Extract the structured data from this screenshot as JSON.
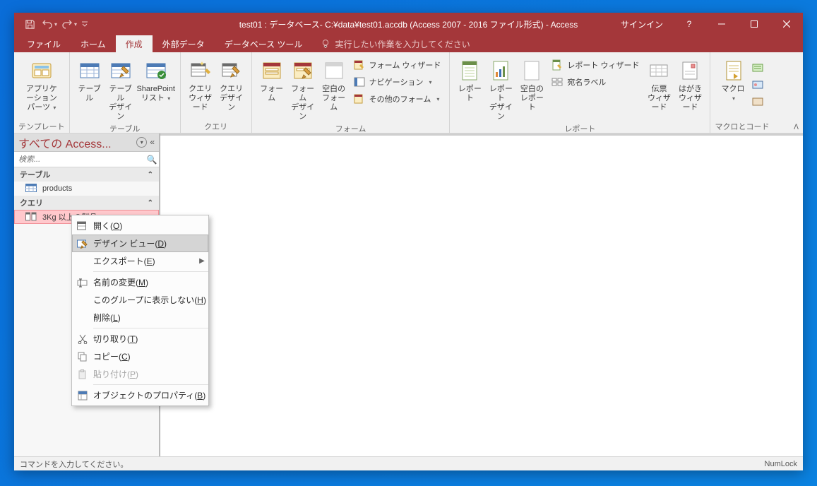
{
  "titlebar": {
    "title": "test01 : データベース- C:¥data¥test01.accdb (Access 2007 - 2016 ファイル形式) - Access",
    "signin": "サインイン"
  },
  "tabs": {
    "file": "ファイル",
    "home": "ホーム",
    "create": "作成",
    "external_data": "外部データ",
    "db_tools": "データベース ツール",
    "tellme_placeholder": "実行したい作業を入力してください"
  },
  "ribbon": {
    "templates": {
      "group_label": "テンプレート",
      "app_parts": "アプリケーション\nパーツ"
    },
    "tables": {
      "group_label": "テーブル",
      "table": "テーブル",
      "table_design": "テーブル\nデザイン",
      "sharepoint": "SharePoint\nリスト"
    },
    "queries": {
      "group_label": "クエリ",
      "wizard": "クエリ\nウィザード",
      "design": "クエリ\nデザイン"
    },
    "forms": {
      "group_label": "フォーム",
      "form": "フォーム",
      "form_design": "フォーム\nデザイン",
      "blank_form": "空白の\nフォーム",
      "wizard": "フォーム ウィザード",
      "navigation": "ナビゲーション",
      "other": "その他のフォーム"
    },
    "reports": {
      "group_label": "レポート",
      "report": "レポート",
      "report_design": "レポート\nデザイン",
      "blank_report": "空白の\nレポート",
      "wizard": "レポート ウィザード",
      "labels": "宛名ラベル"
    },
    "legacy": {
      "postcard": "はがき\nウィザード",
      "voucher": "伝票\nウィザード"
    },
    "macros": {
      "group_label": "マクロとコード",
      "macro": "マクロ"
    }
  },
  "navpane": {
    "title": "すべての Access...",
    "search_placeholder": "検索...",
    "tables_label": "テーブル",
    "queries_label": "クエリ",
    "items_tables": [
      {
        "label": "products"
      }
    ],
    "items_queries": [
      {
        "label": "3Kg 以上の製品"
      }
    ]
  },
  "contextmenu": {
    "open": "開く(O)",
    "design_view": "デザイン ビュー(D)",
    "export": "エクスポート(E)",
    "rename": "名前の変更(M)",
    "hide_group": "このグループに表示しない(H)",
    "delete": "削除(L)",
    "cut": "切り取り(T)",
    "copy": "コピー(C)",
    "paste": "貼り付け(P)",
    "properties": "オブジェクトのプロパティ(B)"
  },
  "statusbar": {
    "message": "コマンドを入力してください。",
    "numlock": "NumLock"
  }
}
